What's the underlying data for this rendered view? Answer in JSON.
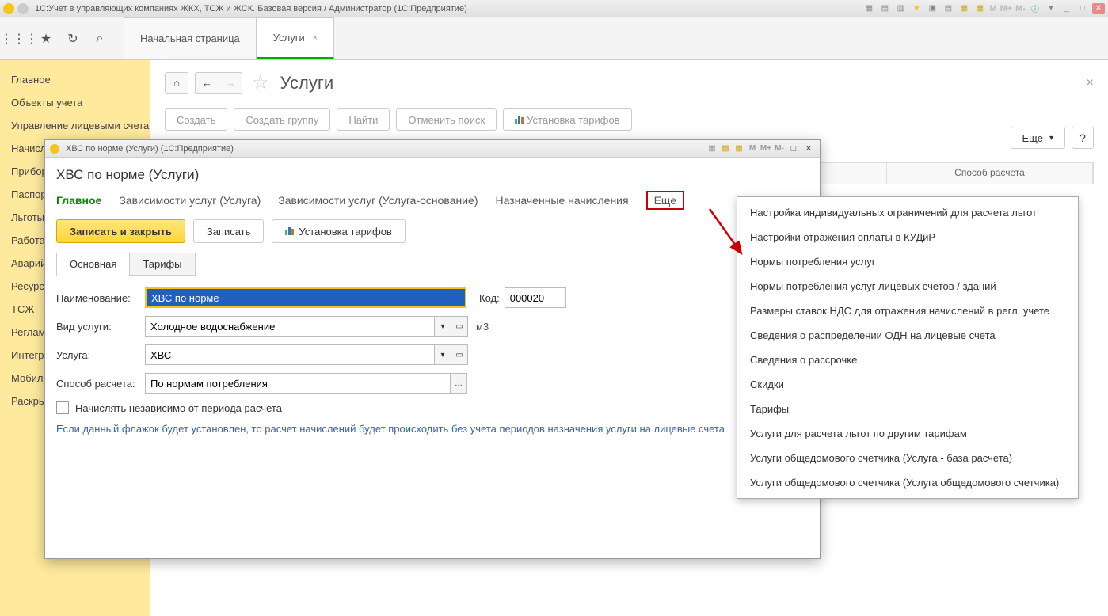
{
  "titlebar": {
    "text": "1С:Учет в управляющих компаниях ЖКХ, ТСЖ и ЖСК. Базовая версия / Администратор  (1С:Предприятие)"
  },
  "tabs": {
    "home": "Начальная страница",
    "services": "Услуги"
  },
  "sidebar": {
    "items": [
      "Главное",
      "Объекты учета",
      "Управление лицевыми счетами",
      "Начисление услуг",
      "Приборы учета",
      "Паспортный стол",
      "Льготы",
      "Работа с должниками",
      "Аварийно-диспетчерская служба",
      "Ресурсоснабжающие организации",
      "ТСЖ",
      "Регламентные операции",
      "Интеграция",
      "Мобильное приложение",
      "Раскрытие информации"
    ]
  },
  "content": {
    "title": "Услуги",
    "actions": {
      "create": "Создать",
      "create_group": "Создать группу",
      "find": "Найти",
      "cancel_find": "Отменить поиск",
      "set_tariffs": "Установка тарифов"
    },
    "more": "Еще",
    "help": "?",
    "table_header": "Способ расчета"
  },
  "modal": {
    "titlebar": "ХВС по норме (Услуги)  (1С:Предприятие)",
    "heading": "ХВС по норме (Услуги)",
    "tabs": {
      "main": "Главное",
      "dep1": "Зависимости услуг (Услуга)",
      "dep2": "Зависимости услуг (Услуга-основание)",
      "assigned": "Назначенные начисления",
      "more": "Еще"
    },
    "actions": {
      "save_close": "Записать и закрыть",
      "save": "Записать",
      "tariffs": "Установка тарифов"
    },
    "inner_tabs": {
      "main": "Основная",
      "tariffs": "Тарифы"
    },
    "form": {
      "name_label": "Наименование:",
      "name_value": "ХВС по норме",
      "code_label": "Код:",
      "code_value": "000020",
      "type_label": "Вид услуги:",
      "type_value": "Холодное водоснабжение",
      "unit": "м3",
      "service_label": "Услуга:",
      "service_value": "ХВС",
      "method_label": "Способ расчета:",
      "method_value": "По нормам потребления",
      "checkbox_label": "Начислять независимо от периода расчета",
      "info": "Если данный флажок будет установлен, то расчет начислений будет происходить без учета периодов назначения услуги на лицевые счета"
    }
  },
  "dropdown": {
    "items": [
      "Настройка индивидуальных ограничений для расчета льгот",
      "Настройки отражения оплаты в КУДиР",
      "Нормы потребления услуг",
      "Нормы потребления услуг лицевых счетов / зданий",
      "Размеры ставок НДС для отражения начислений в регл. учете",
      "Сведения о распределении ОДН на лицевые счета",
      "Сведения о рассрочке",
      "Скидки",
      "Тарифы",
      "Услуги для расчета льгот по другим тарифам",
      "Услуги общедомового счетчика (Услуга - база расчета)",
      "Услуги общедомового счетчика (Услуга общедомового счетчика)"
    ]
  }
}
